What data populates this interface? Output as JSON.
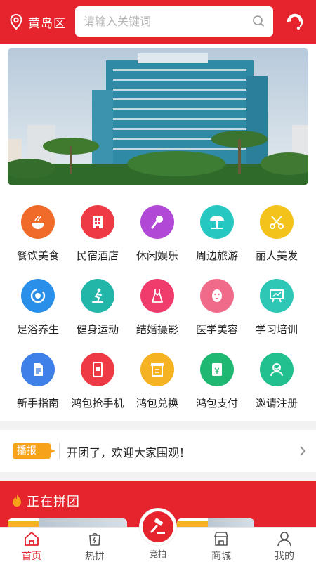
{
  "header": {
    "location": "黄岛区",
    "search_placeholder": "请输入关键词"
  },
  "categories": [
    {
      "label": "餐饮美食",
      "color": "#f06a2a",
      "icon": "food-icon"
    },
    {
      "label": "民宿酒店",
      "color": "#ee3a45",
      "icon": "hotel-icon"
    },
    {
      "label": "休闲娱乐",
      "color": "#b148d6",
      "icon": "microphone-icon"
    },
    {
      "label": "周边旅游",
      "color": "#27c7c1",
      "icon": "beach-umbrella-icon"
    },
    {
      "label": "丽人美发",
      "color": "#f3c21b",
      "icon": "scissors-icon"
    },
    {
      "label": "足浴养生",
      "color": "#2a8fe8",
      "icon": "foot-spa-icon"
    },
    {
      "label": "健身运动",
      "color": "#22b6a9",
      "icon": "fitness-icon"
    },
    {
      "label": "结婚摄影",
      "color": "#ef3c6d",
      "icon": "wedding-dress-icon"
    },
    {
      "label": "医学美容",
      "color": "#f06a8a",
      "icon": "face-mask-icon"
    },
    {
      "label": "学习培训",
      "color": "#2ec7b6",
      "icon": "training-board-icon"
    },
    {
      "label": "新手指南",
      "color": "#3e7fe8",
      "icon": "guide-document-icon"
    },
    {
      "label": "鸿包抢手机",
      "color": "#ee3a45",
      "icon": "phone-grab-icon"
    },
    {
      "label": "鸿包兑换",
      "color": "#f5b324",
      "icon": "exchange-icon"
    },
    {
      "label": "鸿包支付",
      "color": "#1fb873",
      "icon": "wallet-pay-icon"
    },
    {
      "label": "邀请注册",
      "color": "#22c08f",
      "icon": "invite-user-icon"
    }
  ],
  "notice": {
    "badge": "播报",
    "message": "开团了，欢迎大家围观！"
  },
  "group": {
    "title": "正在拼团"
  },
  "tabbar": {
    "items": [
      {
        "label": "首页",
        "icon": "home-icon"
      },
      {
        "label": "热拼",
        "icon": "hot-group-icon"
      },
      {
        "label": "竞拍",
        "icon": "auction-gavel-icon"
      },
      {
        "label": "商城",
        "icon": "mall-icon"
      },
      {
        "label": "我的",
        "icon": "profile-icon"
      }
    ]
  },
  "colors": {
    "brand_red": "#e5242d",
    "notice_orange": "#f7a21b"
  }
}
